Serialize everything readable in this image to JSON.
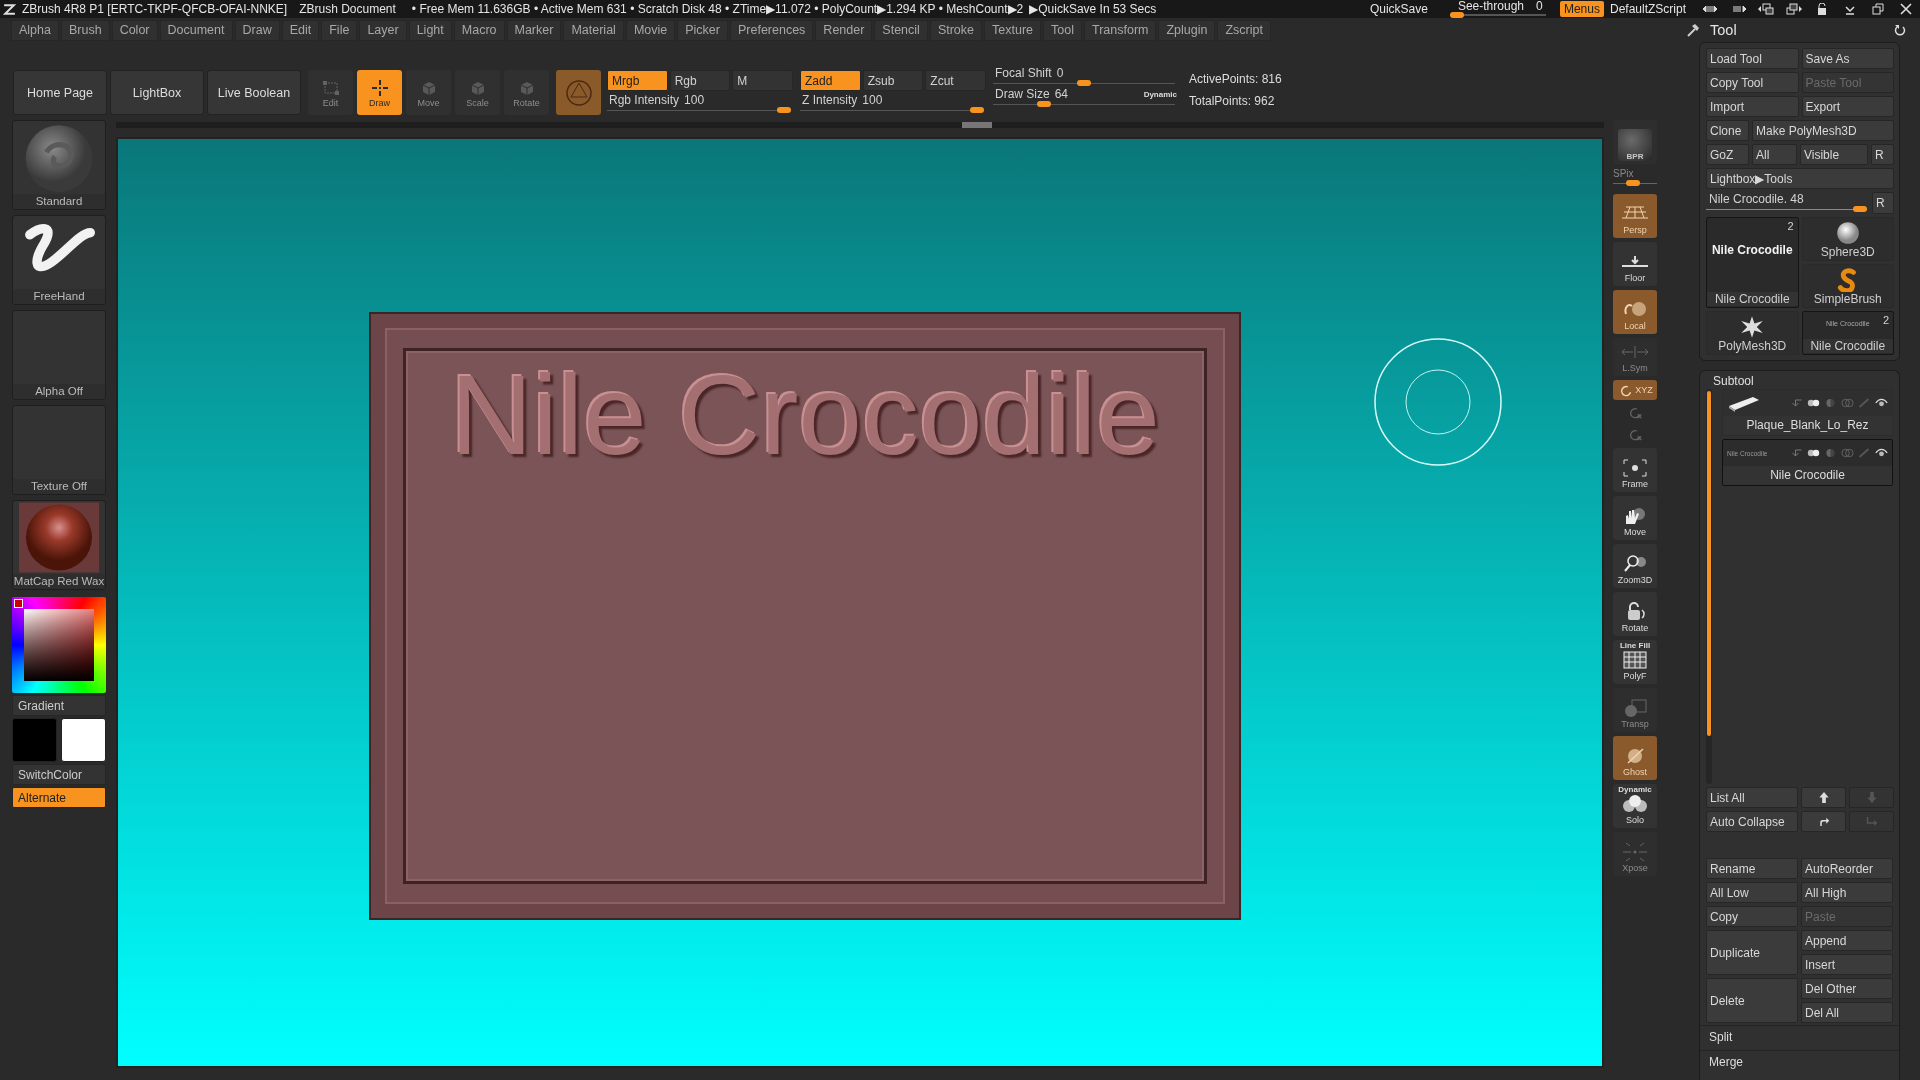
{
  "title_bar": {
    "app_title": "ZBrush 4R8 P1 [ERTC-TKPF-QFCB-OFAI-NNKE]",
    "document": "ZBrush Document",
    "stats": "• Free Mem 11.636GB • Active Mem 631 • Scratch Disk 48 • ZTime▶11.072 • PolyCount▶1.294 KP • MeshCount▶2",
    "quicksave_timer": "▶QuickSave In 53 Secs",
    "quicksave": "QuickSave",
    "see_through": {
      "label": "See-through",
      "value": "0",
      "level": 0
    },
    "menus": {
      "label": "Menus",
      "on": true
    },
    "script": "DefaultZScript"
  },
  "menu_bar": [
    "Alpha",
    "Brush",
    "Color",
    "Document",
    "Draw",
    "Edit",
    "File",
    "Layer",
    "Light",
    "Macro",
    "Marker",
    "Material",
    "Movie",
    "Picker",
    "Preferences",
    "Render",
    "Stencil",
    "Stroke",
    "Texture",
    "Tool",
    "Transform",
    "Zplugin",
    "Zscript"
  ],
  "top_shelf": {
    "buttons": [
      "Home Page",
      "LightBox",
      "Live Boolean"
    ],
    "transform_tools": [
      {
        "label": "Edit",
        "kind": "edit",
        "selected": false,
        "disabled": true
      },
      {
        "label": "Draw",
        "kind": "draw",
        "selected": true,
        "disabled": false
      },
      {
        "label": "Move",
        "kind": "move",
        "selected": false,
        "disabled": true
      },
      {
        "label": "Scale",
        "kind": "scale",
        "selected": false,
        "disabled": true
      },
      {
        "label": "Rotate",
        "kind": "rotate",
        "selected": false,
        "disabled": true
      }
    ],
    "rgb_modes": [
      {
        "label": "Mrgb",
        "selected": true
      },
      {
        "label": "Rgb",
        "selected": false
      },
      {
        "label": "M",
        "selected": false
      }
    ],
    "rgb_intensity": {
      "label": "Rgb Intensity",
      "value": "100",
      "level": 1
    },
    "z_modes": [
      {
        "label": "Zadd",
        "selected": true
      },
      {
        "label": "Zsub",
        "selected": false
      },
      {
        "label": "Zcut",
        "selected": false
      }
    ],
    "z_intensity": {
      "label": "Z Intensity",
      "value": "100",
      "level": 1
    },
    "focal_shift": {
      "label": "Focal Shift",
      "value": "0",
      "level": 0.5
    },
    "draw_size": {
      "label": "Draw Size",
      "value": "64",
      "level": 0.26,
      "badge": "Dynamic"
    },
    "stats": [
      "ActivePoints: 816",
      "TotalPoints: 962"
    ]
  },
  "left_shelf": {
    "items": [
      {
        "label": "Standard",
        "kind": "brush"
      },
      {
        "label": "FreeHand",
        "kind": "stroke"
      },
      {
        "label": "Alpha Off",
        "kind": "empty"
      },
      {
        "label": "Texture Off",
        "kind": "empty"
      },
      {
        "label": "MatCap Red Wax",
        "kind": "material"
      }
    ],
    "gradient": "Gradient",
    "swatches": [
      {
        "color": "#000000"
      },
      {
        "color": "#ffffff"
      }
    ],
    "switch_color": "SwitchColor",
    "alternate": {
      "label": "Alternate",
      "on": true
    }
  },
  "canvas": {
    "model_text": "Nile Crocodile"
  },
  "right_shelf": {
    "bpr": {
      "label": "BPR",
      "disabled": true
    },
    "spix": {
      "label": "SPix",
      "level": 0.45
    },
    "buttons": [
      {
        "label": "Persp",
        "kind": "persp",
        "on": true,
        "disabled": false
      },
      {
        "label": "Floor",
        "kind": "floor",
        "on": false,
        "disabled": false
      },
      {
        "label": "Local",
        "kind": "local",
        "on": true,
        "disabled": false
      },
      {
        "label": "L.Sym",
        "kind": "lsym",
        "on": false,
        "disabled": true
      },
      {
        "label": "XYZ",
        "kind": "xyz",
        "on": true,
        "disabled": false
      },
      {
        "kind": "roty",
        "on": false,
        "disabled": true
      },
      {
        "kind": "rotz",
        "on": false,
        "disabled": true
      },
      {
        "label": "Frame",
        "kind": "frame",
        "on": false,
        "disabled": false
      },
      {
        "label": "Move",
        "kind": "move",
        "on": false,
        "disabled": false
      },
      {
        "label": "Zoom3D",
        "kind": "zoom",
        "on": false,
        "disabled": false
      },
      {
        "label": "Rotate",
        "kind": "rotate",
        "on": false,
        "disabled": false
      },
      {
        "header": "Line Fill",
        "label": "PolyF",
        "kind": "polyf",
        "on": false,
        "disabled": false
      },
      {
        "label": "Transp",
        "kind": "transp",
        "on": false,
        "disabled": true
      },
      {
        "label": "Ghost",
        "kind": "ghost",
        "on": true,
        "disabled": false
      },
      {
        "header": "Dynamic",
        "label": "Solo",
        "kind": "solo",
        "on": false,
        "disabled": false
      },
      {
        "label": "Xpose",
        "kind": "xpose",
        "on": false,
        "disabled": true
      }
    ]
  },
  "tool_panel": {
    "title": "Tool",
    "rows": [
      {
        "kind": "pair",
        "buttons": [
          {
            "label": "Load Tool",
            "disabled": false
          },
          {
            "label": "Save As",
            "disabled": false
          }
        ]
      },
      {
        "kind": "pair",
        "buttons": [
          {
            "label": "Copy Tool",
            "disabled": false
          },
          {
            "label": "Paste Tool",
            "disabled": true
          }
        ]
      },
      {
        "kind": "pair",
        "buttons": [
          {
            "label": "Import",
            "disabled": false
          },
          {
            "label": "Export",
            "disabled": false
          }
        ]
      },
      {
        "kind": "clone",
        "buttons": [
          {
            "label": "Clone",
            "disabled": false
          },
          {
            "label": "Make PolyMesh3D",
            "disabled": false
          }
        ]
      },
      {
        "kind": "quad",
        "buttons": [
          {
            "label": "GoZ",
            "disabled": false
          },
          {
            "label": "All",
            "disabled": false
          },
          {
            "label": "Visible",
            "disabled": false
          },
          {
            "label": "R",
            "disabled": false
          }
        ]
      },
      {
        "kind": "single",
        "buttons": [
          {
            "label": "Lightbox▶Tools",
            "disabled": false
          }
        ]
      }
    ],
    "tool_slider": {
      "label": "Nile Crocodile. 48",
      "level": 1,
      "reset": "R"
    },
    "thumbnails": [
      {
        "kind": "text_big",
        "preview": "Nile Crocodile",
        "count": "2",
        "caption": "Nile Crocodile",
        "selected": true
      },
      {
        "kind": "sphere",
        "caption": "Sphere3D",
        "selected": false
      },
      {
        "kind": "simplebrush",
        "caption": "SimpleBrush",
        "selected": false
      },
      {
        "kind": "star",
        "caption": "PolyMesh3D",
        "selected": false
      },
      {
        "kind": "text_small",
        "preview": "Nile Crocodile",
        "count": "2",
        "caption": "Nile Crocodile",
        "selected": true
      }
    ]
  },
  "subtool": {
    "title": "Subtool",
    "items": [
      {
        "kind": "mesh",
        "name": "Plaque_Blank_Lo_Rez",
        "selected": false
      },
      {
        "kind": "text",
        "preview": "Nile Crocodile",
        "name": "Nile Crocodile",
        "selected": true
      }
    ],
    "list_all": "List All",
    "auto_collapse": "Auto Collapse",
    "arrows": [
      {
        "kind": "up",
        "disabled": false
      },
      {
        "kind": "down",
        "disabled": true
      },
      {
        "kind": "redo",
        "disabled": false
      },
      {
        "kind": "return",
        "disabled": true
      }
    ],
    "action_columns": [
      [
        {
          "label": "Rename",
          "kind": "cell",
          "disabled": false
        },
        {
          "label": "All Low",
          "kind": "cell",
          "disabled": false
        },
        {
          "label": "Copy",
          "kind": "cell",
          "disabled": false
        },
        {
          "label": "Duplicate",
          "kind": "tall",
          "disabled": false
        },
        {
          "label": "Delete",
          "kind": "tall",
          "disabled": false
        }
      ],
      [
        {
          "label": "AutoReorder",
          "kind": "cell",
          "disabled": false
        },
        {
          "label": "All High",
          "kind": "cell",
          "disabled": false
        },
        {
          "label": "Paste",
          "kind": "cell",
          "disabled": true
        },
        {
          "label": "Append",
          "kind": "cell",
          "disabled": false
        },
        {
          "label": "Insert",
          "kind": "cell",
          "disabled": false
        },
        {
          "label": "Del Other",
          "kind": "cell",
          "disabled": false
        },
        {
          "label": "Del All",
          "kind": "cell",
          "disabled": false
        }
      ]
    ],
    "sections": [
      "Split",
      "Merge"
    ]
  }
}
